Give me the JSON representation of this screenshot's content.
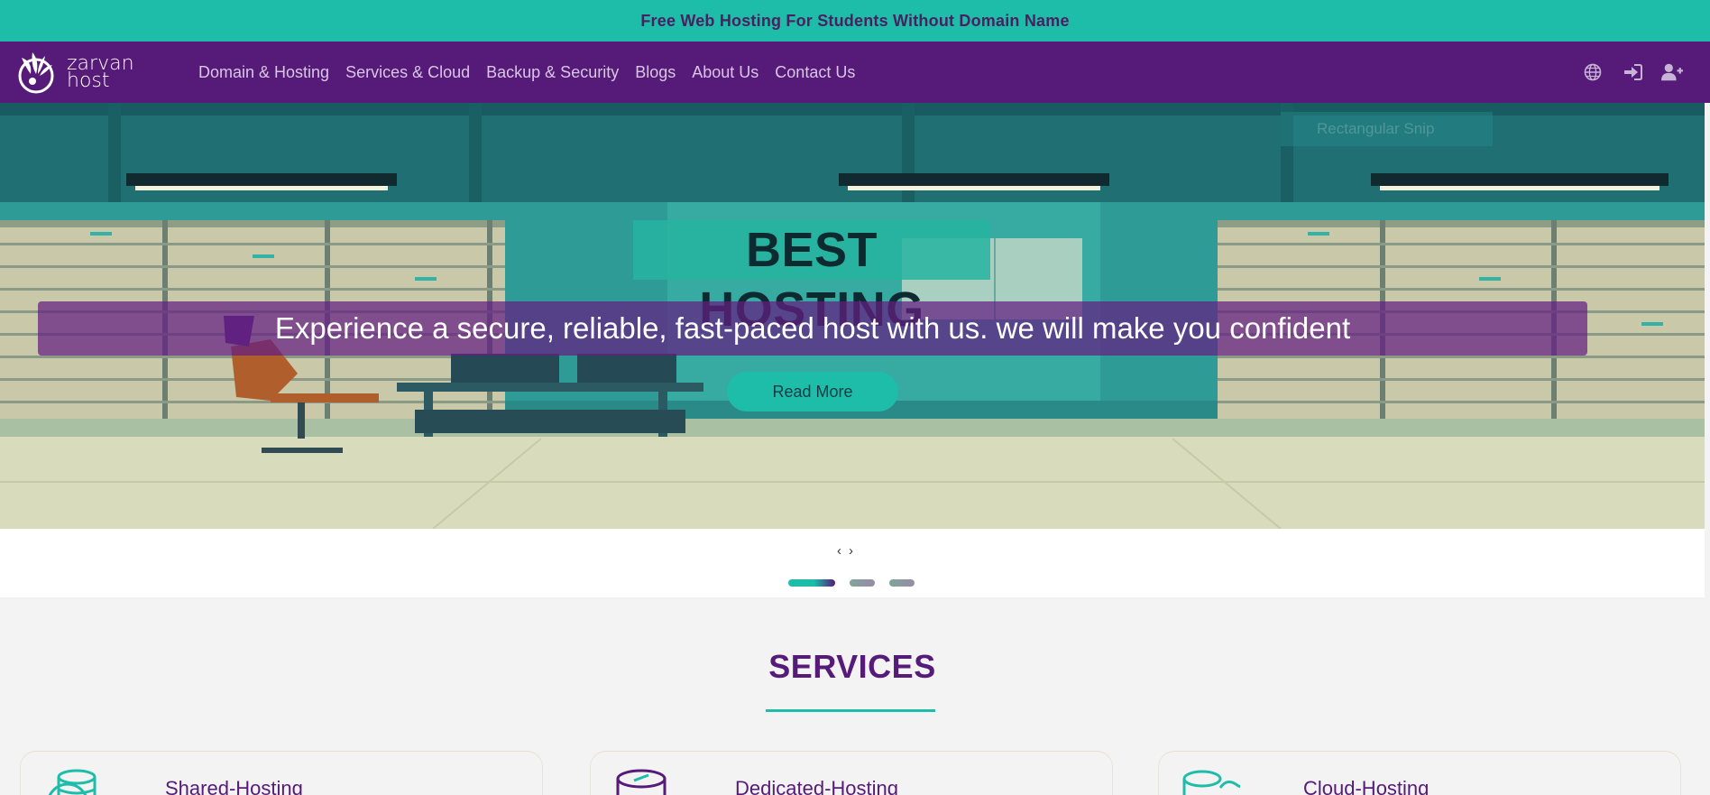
{
  "announcement": "Free Web Hosting For Students Without Domain Name",
  "logo": {
    "line1": "zarvan",
    "line2": "host"
  },
  "nav": {
    "links": [
      "Domain & Hosting",
      "Services & Cloud",
      "Backup & Security",
      "Blogs",
      "About Us",
      "Contact Us"
    ],
    "icons": [
      "globe-icon",
      "sign-in-icon",
      "user-plus-icon"
    ]
  },
  "hero": {
    "title": "BEST HOSTING",
    "subtitle": "Experience a secure, reliable, fast-paced host with us. we will make you confident",
    "button": "Read More",
    "overlay_ghost_text": "Rectangular Snip"
  },
  "slider": {
    "prev": "‹",
    "next": "›",
    "active_index": 0,
    "count": 3
  },
  "services": {
    "title": "SERVICES",
    "cards": [
      {
        "title": "Shared-Hosting",
        "icon": "database-globe-icon"
      },
      {
        "title": "Dedicated-Hosting",
        "icon": "database-icon"
      },
      {
        "title": "Cloud-Hosting",
        "icon": "cloud-database-icon"
      }
    ]
  },
  "colors": {
    "teal": "#1dbdaa",
    "purple": "#561a79",
    "background": "#f3f3f3"
  }
}
